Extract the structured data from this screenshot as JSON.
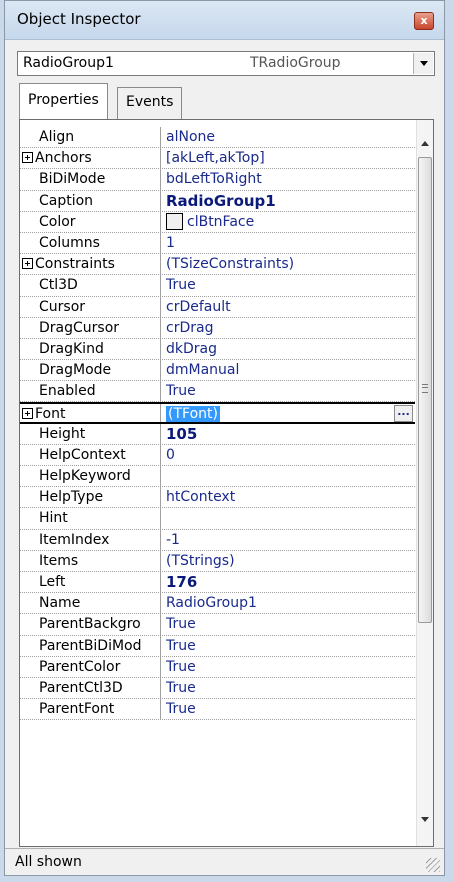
{
  "window": {
    "title": "Object Inspector",
    "close_label": "x"
  },
  "object_selector": {
    "name": "RadioGroup1",
    "type": "TRadioGroup"
  },
  "tabs": [
    {
      "label": "Properties",
      "active": true
    },
    {
      "label": "Events",
      "active": false
    }
  ],
  "properties": [
    {
      "name": "Align",
      "value": "alNone"
    },
    {
      "name": "Anchors",
      "value": "[akLeft,akTop]",
      "expandable": true
    },
    {
      "name": "BiDiMode",
      "value": "bdLeftToRight"
    },
    {
      "name": "Caption",
      "value": "RadioGroup1",
      "bold": true
    },
    {
      "name": "Color",
      "value": "clBtnFace",
      "swatch": "#f0f0f0"
    },
    {
      "name": "Columns",
      "value": "1"
    },
    {
      "name": "Constraints",
      "value": "(TSizeConstraints)",
      "expandable": true
    },
    {
      "name": "Ctl3D",
      "value": "True"
    },
    {
      "name": "Cursor",
      "value": "crDefault"
    },
    {
      "name": "DragCursor",
      "value": "crDrag"
    },
    {
      "name": "DragKind",
      "value": "dkDrag"
    },
    {
      "name": "DragMode",
      "value": "dmManual"
    },
    {
      "name": "Enabled",
      "value": "True"
    },
    {
      "name": "Font",
      "value": "(TFont)",
      "expandable": true,
      "selected": true,
      "ellipsis": "..."
    },
    {
      "name": "Height",
      "value": "105",
      "bold": true
    },
    {
      "name": "HelpContext",
      "value": "0"
    },
    {
      "name": "HelpKeyword",
      "value": ""
    },
    {
      "name": "HelpType",
      "value": "htContext"
    },
    {
      "name": "Hint",
      "value": ""
    },
    {
      "name": "ItemIndex",
      "value": "-1"
    },
    {
      "name": "Items",
      "value": "(TStrings)"
    },
    {
      "name": "Left",
      "value": "176",
      "bold": true
    },
    {
      "name": "Name",
      "value": "RadioGroup1"
    },
    {
      "name": "ParentBackgro",
      "value": "True"
    },
    {
      "name": "ParentBiDiMod",
      "value": "True"
    },
    {
      "name": "ParentColor",
      "value": "True"
    },
    {
      "name": "ParentCtl3D",
      "value": "True"
    },
    {
      "name": "ParentFont",
      "value": "True"
    }
  ],
  "status": {
    "text": "All shown"
  }
}
